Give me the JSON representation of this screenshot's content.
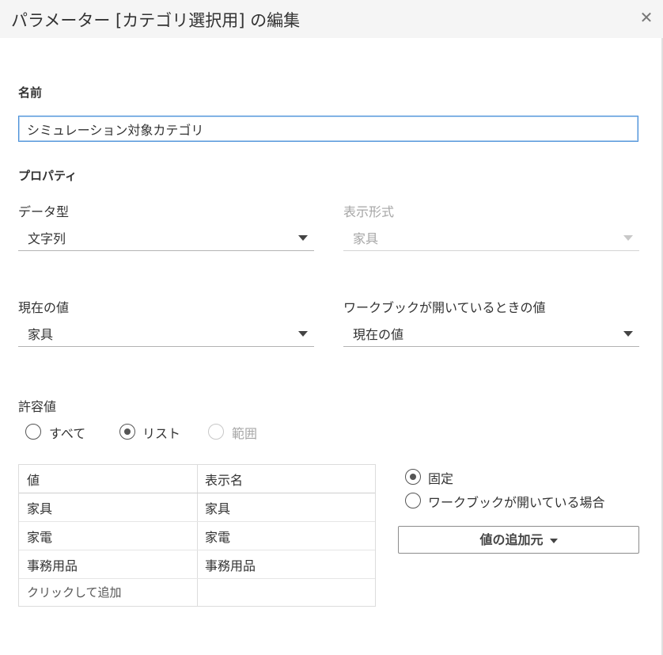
{
  "dialog": {
    "title": "パラメーター [カテゴリ選択用] の編集",
    "close_icon": "close-icon"
  },
  "name_section": {
    "label": "名前",
    "value": "シミュレーション対象カテゴリ"
  },
  "properties": {
    "label": "プロパティ",
    "data_type": {
      "label": "データ型",
      "value": "文字列"
    },
    "display_format": {
      "label": "表示形式",
      "value": "家具"
    },
    "current_value": {
      "label": "現在の値",
      "value": "家具"
    },
    "workbook_open_value": {
      "label": "ワークブックが開いているときの値",
      "value": "現在の値"
    }
  },
  "allowed_values": {
    "label": "許容値",
    "options": [
      {
        "label": "すべて",
        "checked": false,
        "disabled": false
      },
      {
        "label": "リスト",
        "checked": true,
        "disabled": false
      },
      {
        "label": "範囲",
        "checked": false,
        "disabled": true
      }
    ]
  },
  "values_table": {
    "headers": [
      "値",
      "表示名"
    ],
    "rows": [
      [
        "家具",
        "家具"
      ],
      [
        "家電",
        "家電"
      ],
      [
        "事務用品",
        "事務用品"
      ]
    ],
    "add_placeholder": "クリックして追加"
  },
  "list_source": {
    "options": [
      {
        "label": "固定",
        "checked": true
      },
      {
        "label": "ワークブックが開いている場合",
        "checked": false
      }
    ],
    "add_values_button": "値の追加元"
  },
  "colors": {
    "focus_border": "#4a90d9",
    "titlebar_bg": "#f5f5f5",
    "disabled_text": "#a6a6a6"
  }
}
